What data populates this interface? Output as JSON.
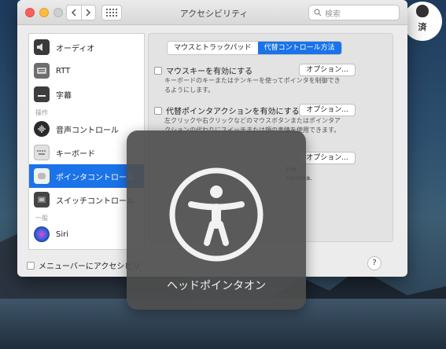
{
  "window": {
    "title": "アクセシビリティ",
    "search_placeholder": "検索"
  },
  "sidebar": {
    "items": [
      {
        "label": "オーディオ",
        "icon": "speaker-icon"
      },
      {
        "label": "RTT",
        "icon": "rtt-phone-icon"
      },
      {
        "label": "字幕",
        "icon": "captions-icon"
      },
      {
        "label": "音声コントロール",
        "icon": "voice-control-icon"
      },
      {
        "label": "キーボード",
        "icon": "keyboard-icon"
      },
      {
        "label": "ポインタコントロール",
        "icon": "pointer-control-icon",
        "selected": true
      },
      {
        "label": "スイッチコントロール",
        "icon": "switch-control-icon"
      },
      {
        "label": "Siri",
        "icon": "siri-icon"
      }
    ],
    "section_headers": [
      "操作",
      "一般"
    ]
  },
  "tabs": [
    {
      "label": "マウスとトラックパッド",
      "active": false
    },
    {
      "label": "代替コントロール方法",
      "active": true
    }
  ],
  "options": {
    "mouse_keys": {
      "label": "マウスキーを有効にする",
      "description_line1": "キーボードのキーまたはテンキーを使ってポインタを制御でき",
      "description_line2": "るようにします。",
      "button": "オプション..."
    },
    "alt_pointer": {
      "label": "代替ポインタアクションを有効にする",
      "description_line1": "左クリックや右クリックなどのマウスボタンまたはポインタア",
      "description_line2": "クションの代わりにスイッチまたは顔の表情を使用できます。",
      "button": "オプション..."
    },
    "head_pointer": {
      "button": "オプション...",
      "desc_tail1": "the",
      "desc_tail2": "camera."
    }
  },
  "bottom": {
    "menubar_label": "メニューバーにアクセシビリ",
    "help": "?"
  },
  "hud": {
    "label": "ヘッドポインタオン",
    "icon": "accessibility-icon"
  },
  "watermark": {
    "text": "済",
    "icon": "apple-logo-icon"
  },
  "colors": {
    "accent": "#1a73e8",
    "close": "#fc605c",
    "minimize": "#fdbc40"
  }
}
